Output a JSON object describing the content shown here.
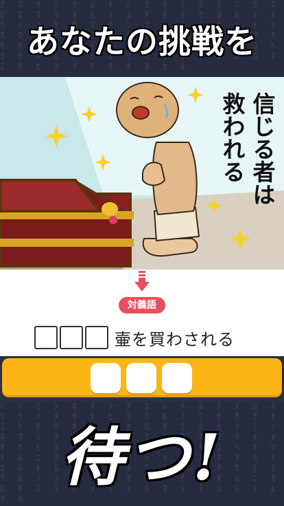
{
  "header": {
    "title": "あなたの挑戦を"
  },
  "scene": {
    "caption_line1": "信じる者は",
    "caption_line2": "救われる"
  },
  "quiz": {
    "tag": "対義語",
    "blank_count": 3,
    "sentence_text": "壷を買わされる"
  },
  "answer": {
    "slot_count": 3
  },
  "footer": {
    "wait_text": "待つ!"
  },
  "colors": {
    "answer_bar": "#fbb515",
    "tag_bg": "#e6505e",
    "arrow": "#e6505e",
    "scene_bg": "#c9e8ea"
  }
}
